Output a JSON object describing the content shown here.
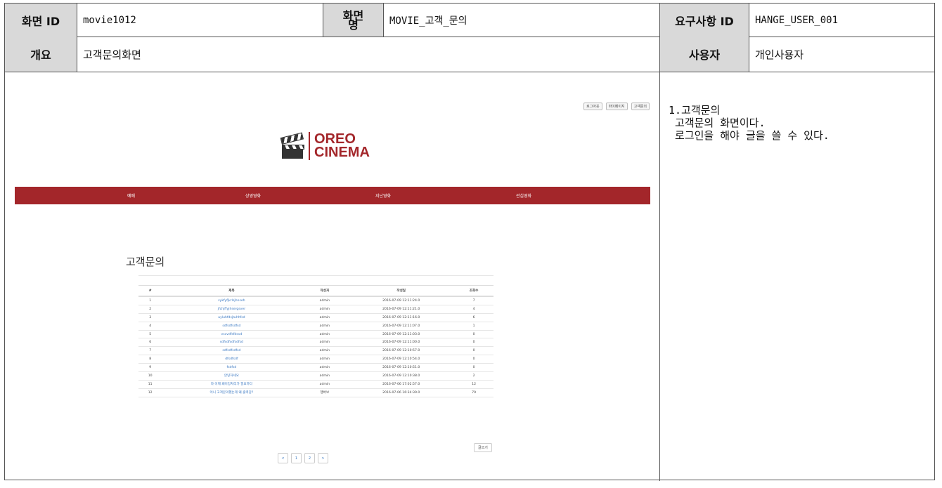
{
  "spec": {
    "screen_id_label": "화면 ID",
    "screen_id_value": "movie1012",
    "screen_name_label": "화면명",
    "screen_name_value": "MOVIE_고객_문의",
    "req_id_label": "요구사항 ID",
    "req_id_value": "HANGE_USER_001",
    "overview_label": "개요",
    "overview_value": "고객문의화면",
    "user_label": "사용자",
    "user_value": "개인사용자",
    "description": "1.고객문의\n 고객문의 화면이다.\n 로그인을 해야 글을 쓸 수 있다."
  },
  "site": {
    "top_links": [
      "로그아웃",
      "마이페이지",
      "고객문의"
    ],
    "logo_line1": "OREO",
    "logo_line2": "CINEMA",
    "brand_color": "#a3262a",
    "nav": [
      "예매",
      "상영영화",
      "지난영화",
      "관심영화"
    ],
    "page_title": "고객문의",
    "table": {
      "headers": [
        "#",
        "제목",
        "작성자",
        "작성일",
        "조회수"
      ],
      "rows": [
        [
          "1",
          "sykfyfjkrlsjhnseh",
          "admin",
          "2016-07-09 12:11:24.0",
          "7"
        ],
        [
          "2",
          "jfchjffyjhsergsver",
          "admin",
          "2016-07-09 12:11:21.0",
          "4"
        ],
        [
          "3",
          "uyluhfdsjtuhhfsd",
          "admin",
          "2016-07-09 12:11:16.0",
          "6"
        ],
        [
          "4",
          "sdfsdfsdfsd",
          "admin",
          "2016-07-09 12:11:07.0",
          "1"
        ],
        [
          "5",
          "vscvdfsfdsvd",
          "admin",
          "2016-07-09 12:11:03.0",
          "0"
        ],
        [
          "6",
          "sdfsdfsdfsdfsd",
          "admin",
          "2016-07-09 12:11:00.0",
          "0"
        ],
        [
          "7",
          "sdfsdfsdfsd",
          "admin",
          "2016-07-09 12:10:57.0",
          "0"
        ],
        [
          "8",
          "dfsdfsdf",
          "admin",
          "2016-07-09 12:10:54.0",
          "0"
        ],
        [
          "9",
          "fsdfsd",
          "admin",
          "2016-07-09 12:10:51.0",
          "0"
        ],
        [
          "10",
          "안녕하세요",
          "admin",
          "2016-07-09 12:10:38.0",
          "2"
        ],
        [
          "11",
          "자 이제 페이징처리가 필요하다",
          "admin",
          "2016-07-06 17:02:57.0",
          "12"
        ],
        [
          "12",
          "어니 고객문의했는데 왜 출력감?",
          "행바보",
          "2016-07-06 16:34:39.0",
          "79"
        ]
      ]
    },
    "write_button": "글쓰기",
    "pager": [
      "<",
      "1",
      "2",
      ">"
    ]
  }
}
